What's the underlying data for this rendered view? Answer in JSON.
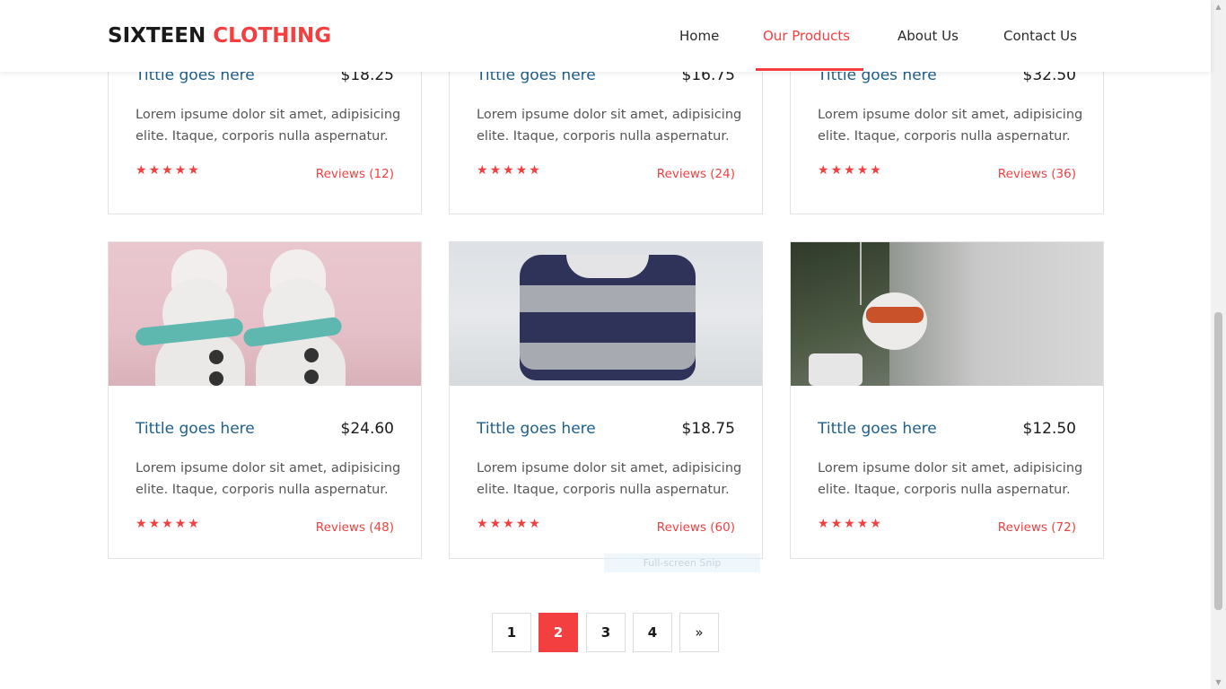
{
  "header": {
    "logo_part1": "SIXTEEN",
    "logo_part2": "CLOTHING",
    "nav": [
      {
        "label": "Home",
        "active": false
      },
      {
        "label": "Our Products",
        "active": true
      },
      {
        "label": "About Us",
        "active": false
      },
      {
        "label": "Contact Us",
        "active": false
      }
    ]
  },
  "products": [
    {
      "title": "Tittle goes here",
      "price": "$18.25",
      "description": "Lorem ipsume dolor sit amet, adipisicing elite. Itaque, corporis nulla aspernatur.",
      "rating": 5,
      "reviews": "Reviews (12)"
    },
    {
      "title": "Tittle goes here",
      "price": "$16.75",
      "description": "Lorem ipsume dolor sit amet, adipisicing elite. Itaque, corporis nulla aspernatur.",
      "rating": 5,
      "reviews": "Reviews (24)"
    },
    {
      "title": "Tittle goes here",
      "price": "$32.50",
      "description": "Lorem ipsume dolor sit amet, adipisicing elite. Itaque, corporis nulla aspernatur.",
      "rating": 5,
      "reviews": "Reviews (36)"
    },
    {
      "title": "Tittle goes here",
      "price": "$24.60",
      "description": "Lorem ipsume dolor sit amet, adipisicing elite. Itaque, corporis nulla aspernatur.",
      "rating": 5,
      "reviews": "Reviews (48)"
    },
    {
      "title": "Tittle goes here",
      "price": "$18.75",
      "description": "Lorem ipsume dolor sit amet, adipisicing elite. Itaque, corporis nulla aspernatur.",
      "rating": 5,
      "reviews": "Reviews (60)"
    },
    {
      "title": "Tittle goes here",
      "price": "$12.50",
      "description": "Lorem ipsume dolor sit amet, adipisicing elite. Itaque, corporis nulla aspernatur.",
      "rating": 5,
      "reviews": "Reviews (72)"
    }
  ],
  "star_glyph": "★",
  "pagination": {
    "pages": [
      "1",
      "2",
      "3",
      "4"
    ],
    "current": "2",
    "next": "»"
  },
  "overlay": {
    "snip_label": "Full-screen Snip"
  },
  "colors": {
    "accent": "#f33f3f",
    "title_blue": "#1e5f8c"
  }
}
